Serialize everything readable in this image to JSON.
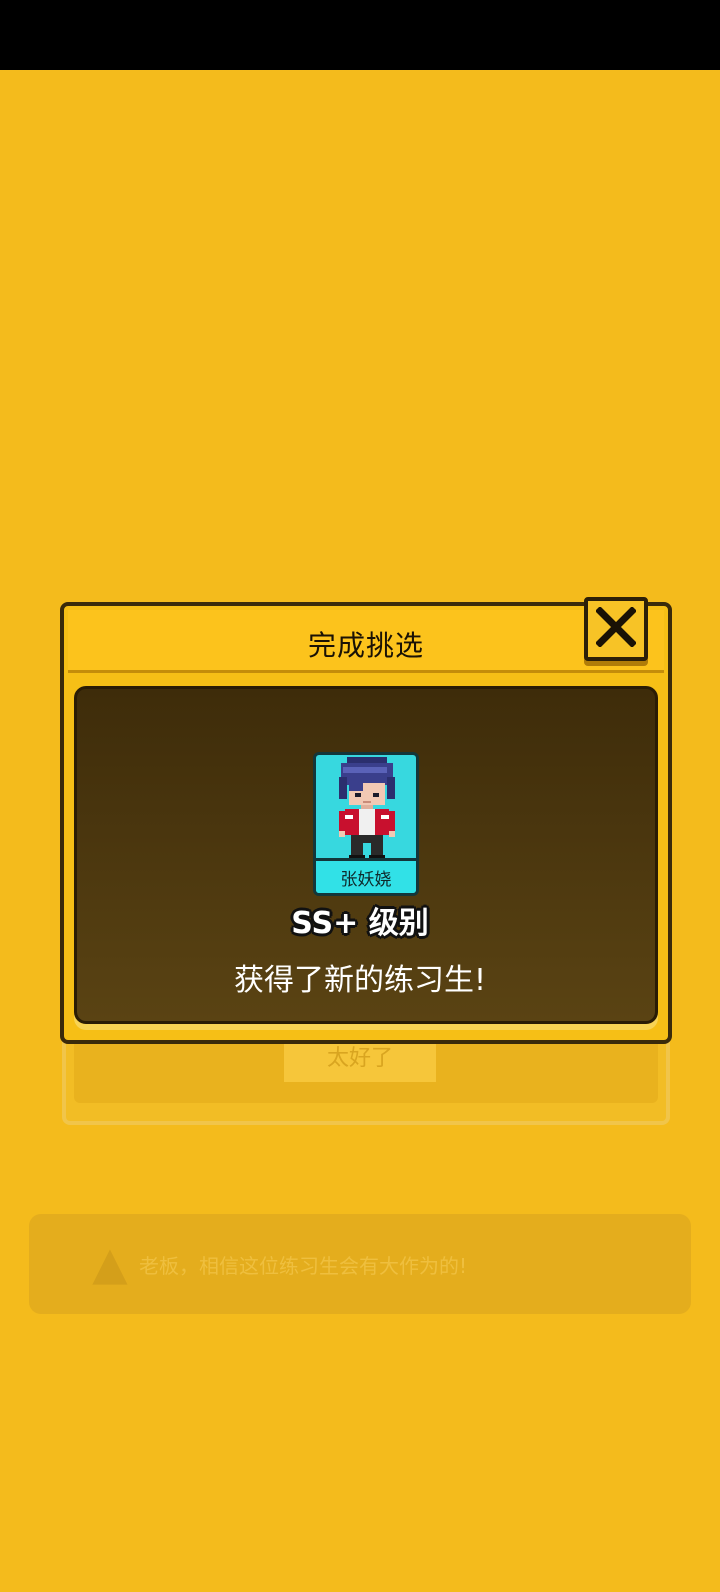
{
  "background": {
    "button_label": "太好了",
    "tip_text": "老板，相信这位练习生会有大作为的!",
    "tip_icon": "hat-icon"
  },
  "popup": {
    "title": "完成挑选",
    "close_icon": "close-icon",
    "trainee": {
      "name": "张妖娆",
      "grade": "SS+ 级别",
      "card_color": "#37d8df"
    },
    "message": "获得了新的练习生!"
  }
}
